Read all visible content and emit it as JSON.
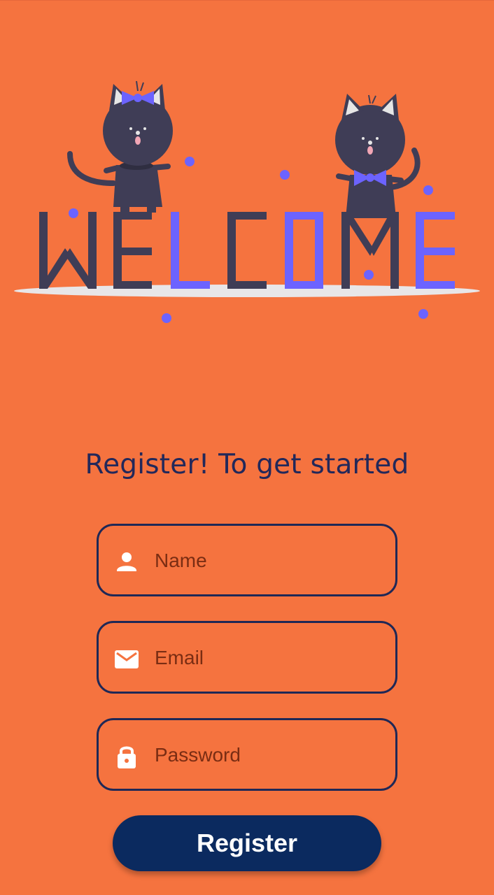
{
  "colors": {
    "background": "#F5733F",
    "cat_body": "#3F3D56",
    "accent_purple": "#6C63FF",
    "field_border": "#1F2856",
    "field_text": "#7A2D13",
    "button_bg": "#0B2A5F",
    "button_text": "#FFFFFF",
    "icon_fill": "#FFFFFF"
  },
  "illustration": {
    "alt_text": "WELCOME"
  },
  "subtitle": "Register! To get started",
  "form": {
    "name": {
      "placeholder": "Name",
      "value": "",
      "icon": "person-icon"
    },
    "email": {
      "placeholder": "Email",
      "value": "",
      "icon": "mail-icon"
    },
    "password": {
      "placeholder": "Password",
      "value": "",
      "icon": "lock-icon"
    }
  },
  "register_button": {
    "label": "Register"
  }
}
